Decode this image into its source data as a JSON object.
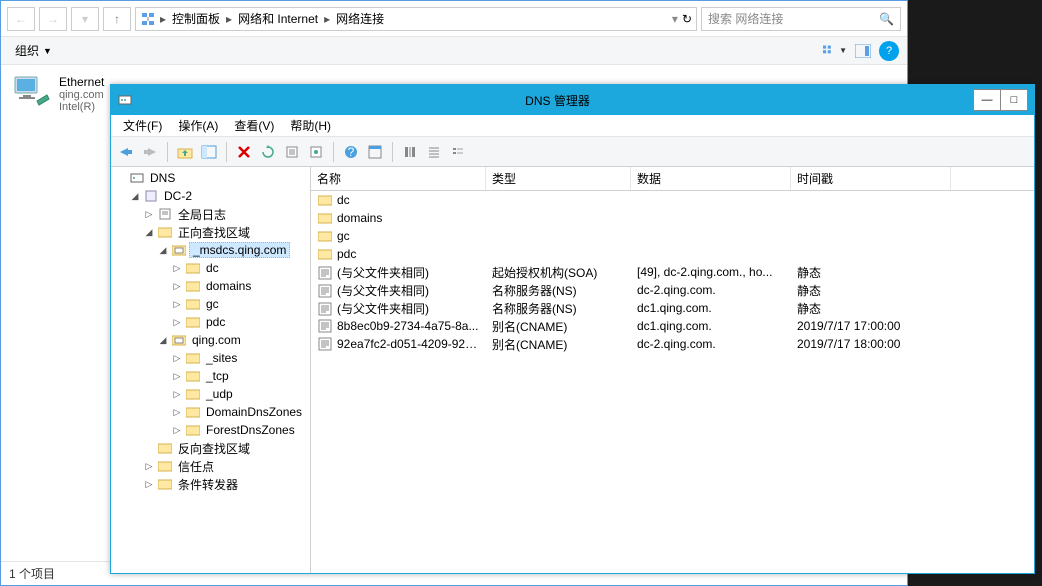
{
  "explorer": {
    "breadcrumb": [
      "控制面板",
      "网络和 Internet",
      "网络连接"
    ],
    "search_placeholder": "搜索 网络连接",
    "toolbar": {
      "organize": "组织"
    },
    "adapter": {
      "name": "Ethernet",
      "sub1": "qing.com",
      "sub2": "Intel(R)"
    },
    "status": "1 个项目"
  },
  "dns": {
    "title": "DNS 管理器",
    "menu": {
      "file": "文件(F)",
      "action": "操作(A)",
      "view": "查看(V)",
      "help": "帮助(H)"
    },
    "tree": {
      "root": "DNS",
      "server": "DC-2",
      "global_log": "全局日志",
      "forward": "正向查找区域",
      "msdcs": "_msdcs.qing.com",
      "dc": "dc",
      "domains": "domains",
      "gc": "gc",
      "pdc": "pdc",
      "qing": "qing.com",
      "sites": "_sites",
      "tcp": "_tcp",
      "udp": "_udp",
      "dd": "DomainDnsZones",
      "fd": "ForestDnsZones",
      "reverse": "反向查找区域",
      "trust": "信任点",
      "cond": "条件转发器"
    },
    "columns": {
      "name": "名称",
      "type": "类型",
      "data": "数据",
      "ts": "时间戳"
    },
    "rows": [
      {
        "icon": "folder",
        "name": "dc",
        "type": "",
        "data": "",
        "ts": ""
      },
      {
        "icon": "folder",
        "name": "domains",
        "type": "",
        "data": "",
        "ts": ""
      },
      {
        "icon": "folder",
        "name": "gc",
        "type": "",
        "data": "",
        "ts": ""
      },
      {
        "icon": "folder",
        "name": "pdc",
        "type": "",
        "data": "",
        "ts": ""
      },
      {
        "icon": "record",
        "name": "(与父文件夹相同)",
        "type": "起始授权机构(SOA)",
        "data": "[49], dc-2.qing.com., ho...",
        "ts": "静态"
      },
      {
        "icon": "record",
        "name": "(与父文件夹相同)",
        "type": "名称服务器(NS)",
        "data": "dc-2.qing.com.",
        "ts": "静态"
      },
      {
        "icon": "record",
        "name": "(与父文件夹相同)",
        "type": "名称服务器(NS)",
        "data": "dc1.qing.com.",
        "ts": "静态"
      },
      {
        "icon": "record",
        "name": "8b8ec0b9-2734-4a75-8a...",
        "type": "别名(CNAME)",
        "data": "dc1.qing.com.",
        "ts": "2019/7/17 17:00:00"
      },
      {
        "icon": "record",
        "name": "92ea7fc2-d051-4209-925...",
        "type": "别名(CNAME)",
        "data": "dc-2.qing.com.",
        "ts": "2019/7/17 18:00:00"
      }
    ]
  }
}
